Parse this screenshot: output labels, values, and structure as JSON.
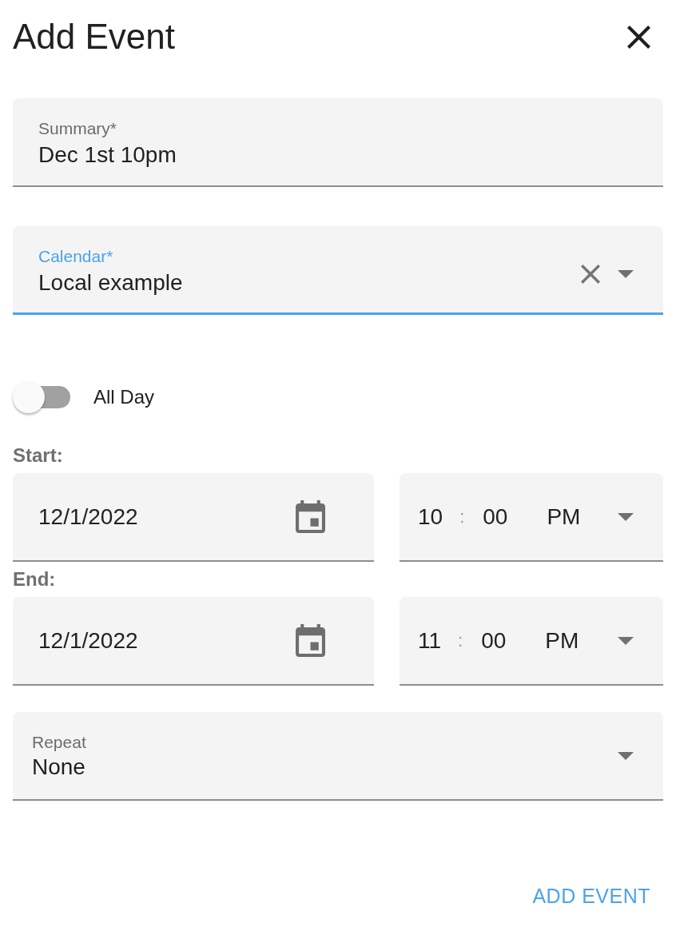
{
  "dialog": {
    "title": "Add Event"
  },
  "fields": [
    {
      "kind": "text",
      "label": "Summary*",
      "value": "Dec 1st 10pm",
      "focused": false,
      "clearable": false
    },
    {
      "kind": "select",
      "label": "Calendar*",
      "value": "Local example",
      "focused": true,
      "clearable": true
    }
  ],
  "all_day": {
    "label": "All Day",
    "on": false
  },
  "ranges": [
    {
      "label": "Start:",
      "date": "12/1/2022",
      "hour": "10",
      "separator": ":",
      "minute": "00",
      "period": "PM"
    },
    {
      "label": "End:",
      "date": "12/1/2022",
      "hour": "11",
      "separator": ":",
      "minute": "00",
      "period": "PM"
    }
  ],
  "repeat": {
    "label": "Repeat",
    "value": "None"
  },
  "actions": [
    {
      "label": "ADD EVENT"
    }
  ]
}
